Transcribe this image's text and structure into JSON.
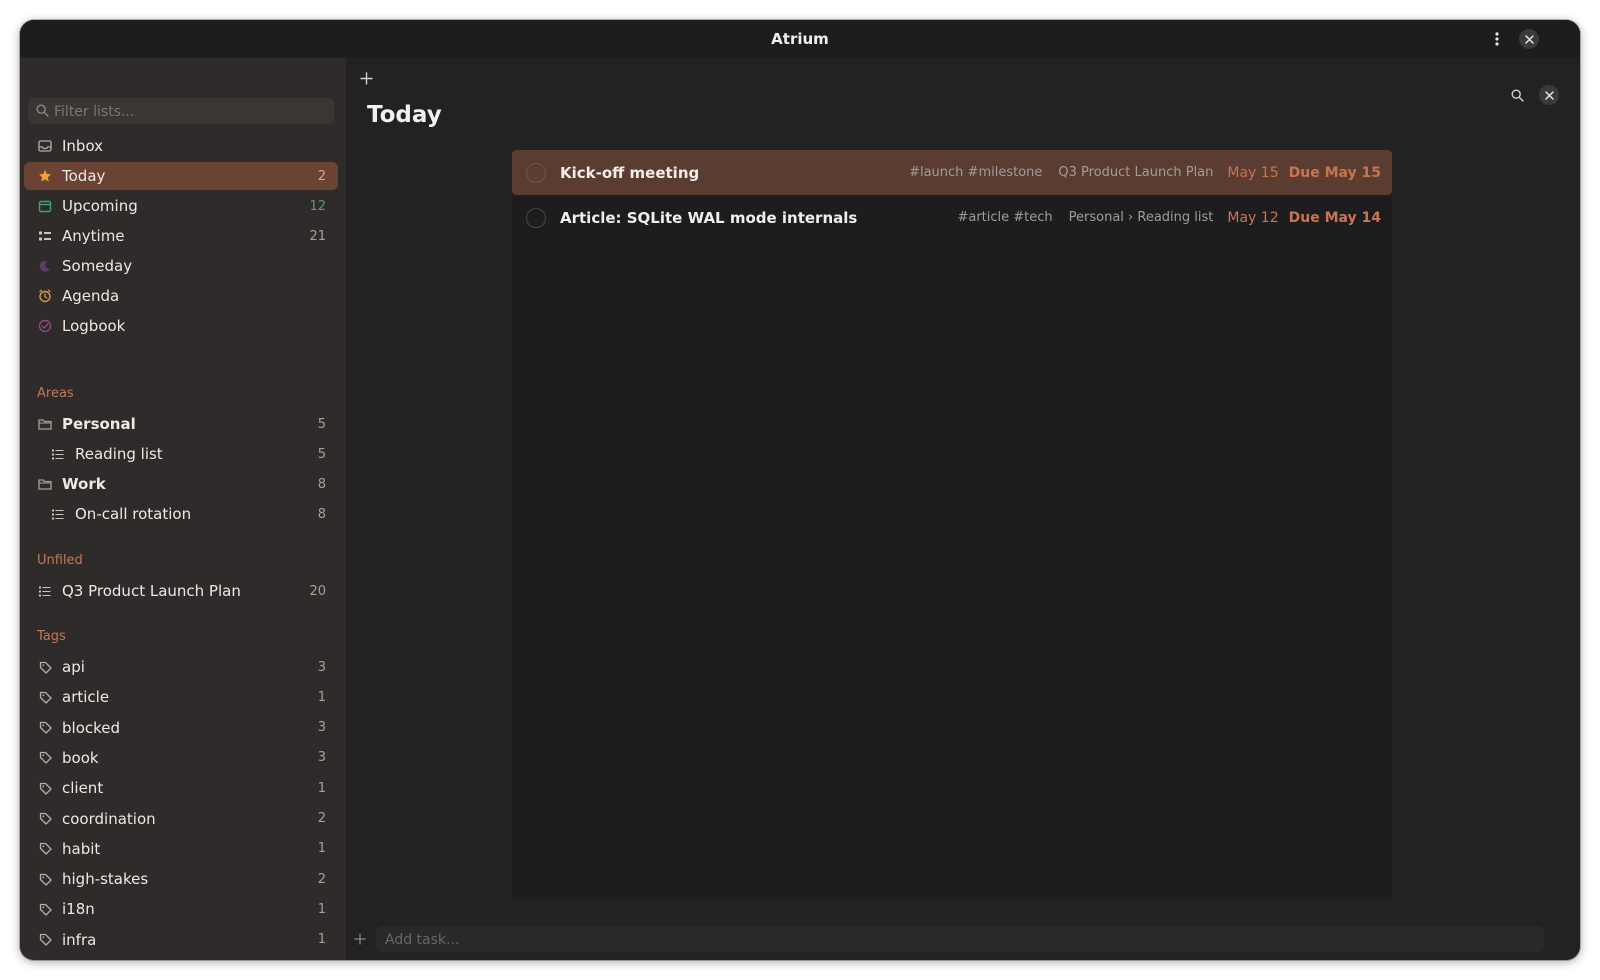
{
  "window": {
    "title": "Atrium"
  },
  "sidebar": {
    "filter_placeholder": "Filter lists...",
    "nav": [
      {
        "label": "Inbox",
        "icon": "inbox-icon",
        "count": ""
      },
      {
        "label": "Today",
        "icon": "star-icon",
        "count": "2",
        "active": true
      },
      {
        "label": "Upcoming",
        "icon": "calendar-icon",
        "count": "12"
      },
      {
        "label": "Anytime",
        "icon": "layers-icon",
        "count": "21"
      },
      {
        "label": "Someday",
        "icon": "moon-icon",
        "count": ""
      },
      {
        "label": "Agenda",
        "icon": "alarm-clock-icon",
        "count": ""
      },
      {
        "label": "Logbook",
        "icon": "check-circle-icon",
        "count": ""
      }
    ],
    "areas_header": "Areas",
    "areas": [
      {
        "label": "Personal",
        "count": "5",
        "sub": {
          "label": "Reading list",
          "count": "5"
        }
      },
      {
        "label": "Work",
        "count": "8",
        "sub": {
          "label": "On-call rotation",
          "count": "8"
        }
      }
    ],
    "unfiled_header": "Unfiled",
    "unfiled": [
      {
        "label": "Q3 Product Launch Plan",
        "count": "20"
      }
    ],
    "tags_header": "Tags",
    "tags": [
      {
        "label": "api",
        "count": "3"
      },
      {
        "label": "article",
        "count": "1"
      },
      {
        "label": "blocked",
        "count": "3"
      },
      {
        "label": "book",
        "count": "3"
      },
      {
        "label": "client",
        "count": "1"
      },
      {
        "label": "coordination",
        "count": "2"
      },
      {
        "label": "habit",
        "count": "1"
      },
      {
        "label": "high-stakes",
        "count": "2"
      },
      {
        "label": "i18n",
        "count": "1"
      },
      {
        "label": "infra",
        "count": "1"
      }
    ]
  },
  "main": {
    "title": "Today",
    "tasks": [
      {
        "title": "Kick-off meeting",
        "tags": "#launch #milestone",
        "project": "Q3 Product Launch Plan",
        "date": "May 15",
        "due": "Due May 15",
        "selected": true
      },
      {
        "title": "Article: SQLite WAL mode internals",
        "tags": "#article #tech",
        "project": "Personal › Reading list",
        "date": "May 12",
        "due": "Due May 14",
        "selected": false
      }
    ],
    "add_task_placeholder": "Add task..."
  },
  "colors": {
    "accent": "#c97552",
    "selection": "#6a4332",
    "sidebar_bg": "#2e2b2a",
    "main_bg": "#222224"
  }
}
